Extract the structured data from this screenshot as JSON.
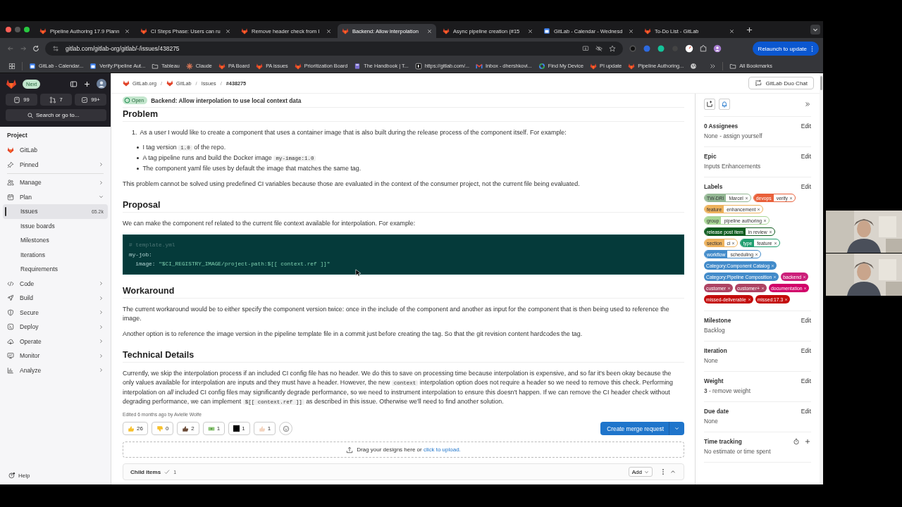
{
  "browser": {
    "tabs": [
      {
        "title": "Pipeline Authoring 17.9 Plann",
        "selected": false
      },
      {
        "title": "CI Steps Phase: Users can ru",
        "selected": false
      },
      {
        "title": "Remove header check from I",
        "selected": false
      },
      {
        "title": "Backend: Allow interpolation",
        "selected": true
      },
      {
        "title": "Async pipeline creation (#15",
        "selected": false
      },
      {
        "title": "GitLab - Calendar - Wednesd",
        "selected": false
      },
      {
        "title": "To-Do List - GitLab",
        "selected": false
      }
    ],
    "url": "gitlab.com/gitlab-org/gitlab/-/issues/438275",
    "relaunch": "Relaunch to update",
    "bookmarks": [
      "GitLab - Calendar...",
      "Verify:Pipeline Aut...",
      "Tableau",
      "Claude",
      "PA Board",
      "PA issues",
      "Prioritization Board",
      "The Handbook | T...",
      "https://gitlab.com/...",
      "Inbox - dhershkovi...",
      "Find My Device",
      "PI update",
      "Pipeline Authoring..."
    ],
    "all_bookmarks": "All Bookmarks"
  },
  "sidebar": {
    "badge": "Next",
    "counters": [
      "99",
      "7",
      "99+"
    ],
    "search": {
      "placeholder": "Search or go to..."
    },
    "section": "Project",
    "items": [
      {
        "kind": "project",
        "label": "GitLab"
      },
      {
        "kind": "group",
        "label": "Pinned",
        "expanded": false
      },
      {
        "kind": "group",
        "label": "Manage",
        "expanded": false
      },
      {
        "kind": "group",
        "label": "Plan",
        "expanded": true,
        "children": [
          {
            "label": "Issues",
            "count": "65.2k",
            "selected": true
          },
          {
            "label": "Issue boards",
            "selected": false
          },
          {
            "label": "Milestones",
            "selected": false
          },
          {
            "label": "Iterations",
            "selected": false
          },
          {
            "label": "Requirements",
            "selected": false
          }
        ]
      },
      {
        "kind": "group",
        "label": "Code",
        "expanded": false
      },
      {
        "kind": "group",
        "label": "Build",
        "expanded": false
      },
      {
        "kind": "group",
        "label": "Secure",
        "expanded": false
      },
      {
        "kind": "group",
        "label": "Deploy",
        "expanded": false
      },
      {
        "kind": "group",
        "label": "Operate",
        "expanded": false
      },
      {
        "kind": "group",
        "label": "Monitor",
        "expanded": false
      },
      {
        "kind": "group",
        "label": "Analyze",
        "expanded": false
      }
    ],
    "help": "Help"
  },
  "main": {
    "breadcrumbs": [
      "GitLab.org",
      "GitLab",
      "Issues",
      "#438275"
    ],
    "breadcrumb_separators": [
      "/",
      "/",
      "/"
    ],
    "duo_chat": "GitLab Duo Chat",
    "status": "Open",
    "title": "Backend: Allow interpolation to use local context data",
    "blocks": [
      {
        "kind": "heading",
        "text": "Problem"
      },
      {
        "kind": "numbered",
        "marker": "1.",
        "segments": [
          {
            "t": "As a user I would like to create a component that uses a container image that is also built during the release process of the component itself. For example:",
            "code": false
          }
        ],
        "bullets": [
          [
            {
              "t": "I tag version ",
              "code": false
            },
            {
              "t": "1.0",
              "code": true
            },
            {
              "t": " of the repo.",
              "code": false
            }
          ],
          [
            {
              "t": "A tag pipeline runs and build the Docker image ",
              "code": false
            },
            {
              "t": "my-image:1.0",
              "code": true
            }
          ],
          [
            {
              "t": "The component yaml file uses by default the image that matches the same tag.",
              "code": false
            }
          ]
        ]
      },
      {
        "kind": "paragraph",
        "segments": [
          {
            "t": "This problem cannot be solved using predefined CI variables because those are evaluated in the context of the consumer project, not the current file being evaluated.",
            "code": false
          }
        ]
      },
      {
        "kind": "heading",
        "text": "Proposal"
      },
      {
        "kind": "paragraph",
        "segments": [
          {
            "t": "We can make the component ref related to the current file context available for interpolation. For example:",
            "code": false
          }
        ]
      },
      {
        "kind": "code",
        "lines": [
          [
            {
              "t": "# template.yml",
              "kind": "comment"
            }
          ],
          [
            {
              "t": "my-job:",
              "kind": "key"
            }
          ],
          [
            {
              "t": "  image: ",
              "kind": "key"
            },
            {
              "t": "\"$CI_REGISTRY_IMAGE/project-path:$[[ context.ref ]]\"",
              "kind": "string"
            }
          ]
        ]
      },
      {
        "kind": "heading",
        "text": "Workaround"
      },
      {
        "kind": "paragraph",
        "segments": [
          {
            "t": "The current workaround would be to either specify the component version twice: once in the include of the component and another as input for the component that is then being used to reference the image.",
            "code": false
          }
        ]
      },
      {
        "kind": "paragraph",
        "segments": [
          {
            "t": "Another option is to reference the image version in the pipeline template file in a commit just before creating the tag. So that the git revision content hardcodes the tag.",
            "code": false
          }
        ]
      },
      {
        "kind": "heading",
        "text": "Technical Details"
      },
      {
        "kind": "paragraph",
        "segments": [
          {
            "t": "Currently, we skip the interpolation process if an included CI config file has no header. We do this to save on processing time because interpolation is expensive, and so far it's been okay because the only values available for interpolation are inputs and they must have a header. However, the new ",
            "code": false
          },
          {
            "t": "context",
            "code": true
          },
          {
            "t": " interpolation option does not require a header so we need to remove this check. Performing interpolation on *all* included CI config files may significantly degrade performance, so we need to instrument interpolation to ensure this doesn't happen. If we can remove the CI header check without degrading performance, we can implement ",
            "code": false
          },
          {
            "t": "$[[ context.ref ]]",
            "code": true
          },
          {
            "t": " as described in this issue. Otherwise we'll need to find another solution.",
            "code": false
          }
        ]
      }
    ],
    "edited": "Edited 6 months ago by Avielle Wolfe",
    "reactions": [
      "26",
      "0",
      "2",
      "1",
      "1",
      "1"
    ],
    "merge_button": "Create merge request",
    "dropzone": {
      "text": "Drag your designs here or ",
      "link": "click to upload."
    },
    "child_items": {
      "title": "Child items",
      "count": "1",
      "add": "Add"
    }
  },
  "right_panel": {
    "sections": [
      {
        "kind": "field",
        "title": "0 Assignees",
        "action": "Edit",
        "value": "None - assign yourself"
      },
      {
        "kind": "field",
        "title": "Epic",
        "action": "Edit",
        "value": "Inputs Enhancements"
      },
      {
        "kind": "labels",
        "title": "Labels",
        "action": "Edit",
        "labels": [
          {
            "scope": "TW-DRI",
            "name": "Marcel",
            "color": "#94b894"
          },
          {
            "scope": "devops",
            "name": "verify",
            "color": "#e9603a"
          },
          {
            "scope": "feature",
            "name": "enhancement",
            "color": "#edb25d"
          },
          {
            "scope": "group",
            "name": "pipeline authoring",
            "color": "#a8d695"
          },
          {
            "scope": "release post item",
            "name": "in review",
            "color": "#0d5b1e"
          },
          {
            "scope": "section",
            "name": "ci",
            "color": "#edb25d"
          },
          {
            "scope": "type",
            "name": "feature",
            "color": "#1f9e6e"
          },
          {
            "scope": "workflow",
            "name": "scheduling",
            "color": "#428bca"
          },
          {
            "name": "Category:Component Catalog",
            "color": "#428bca"
          },
          {
            "name": "Category:Pipeline Composition",
            "color": "#428bca"
          },
          {
            "name": "backend",
            "color": "#cc1f7a"
          },
          {
            "name": "customer",
            "color": "#ad4363"
          },
          {
            "name": "customer+",
            "color": "#ad4363"
          },
          {
            "name": "documentation",
            "color": "#d10069"
          },
          {
            "name": "missed-deliverable",
            "color": "#c40c0c"
          },
          {
            "name": "missed:17.3",
            "color": "#c40c0c"
          }
        ]
      },
      {
        "kind": "field",
        "title": "Milestone",
        "action": "Edit",
        "value": "Backlog"
      },
      {
        "kind": "field",
        "title": "Iteration",
        "action": "Edit",
        "value": "None"
      },
      {
        "kind": "field",
        "title": "Weight",
        "action": "Edit",
        "value": "**3** - remove weight"
      },
      {
        "kind": "field",
        "title": "Due date",
        "action": "Edit",
        "value": "None"
      },
      {
        "kind": "timer",
        "title": "Time tracking",
        "value": "No estimate or time spent"
      }
    ]
  }
}
